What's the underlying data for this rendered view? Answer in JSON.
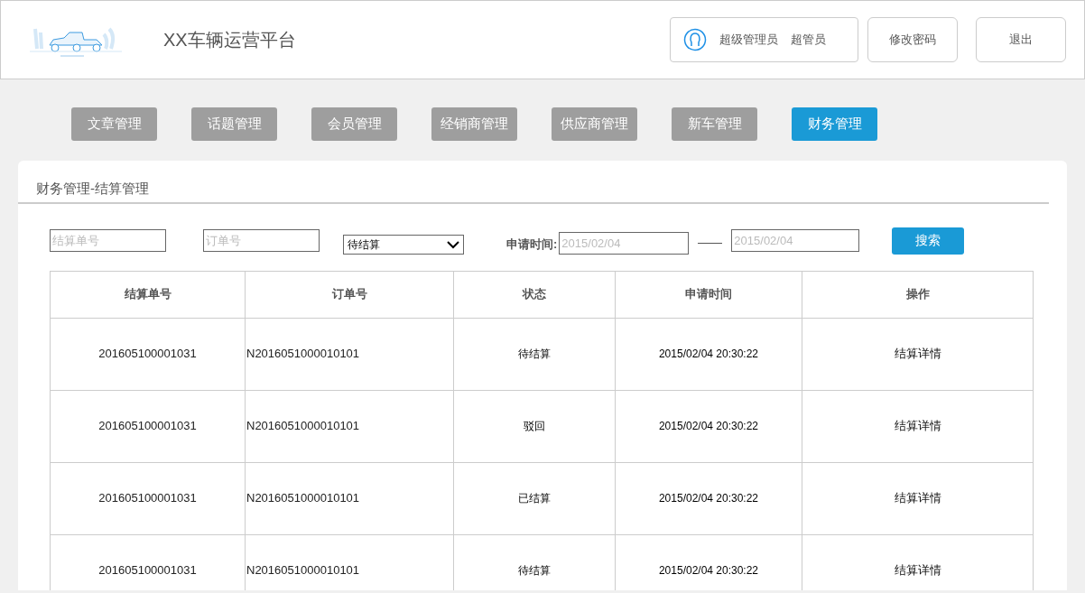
{
  "header": {
    "title": "XX车辆运营平台",
    "user_role": "超级管理员",
    "user_name": "超管员",
    "buttons": [
      "修改密码",
      "退出"
    ]
  },
  "nav": [
    {
      "label": "文章管理",
      "selected": false
    },
    {
      "label": "话题管理",
      "selected": false
    },
    {
      "label": "会员管理",
      "selected": false
    },
    {
      "label": "经销商管理",
      "selected": false
    },
    {
      "label": "供应商管理",
      "selected": false
    },
    {
      "label": "新车管理",
      "selected": false
    },
    {
      "label": "财务管理",
      "selected": true
    }
  ],
  "breadcrumb": "财务管理-结算管理",
  "filters": {
    "settlement_no": {
      "placeholder": "结算单号"
    },
    "order_no": {
      "placeholder": "订单号"
    },
    "status": "待结算",
    "date_label": "申请时间:",
    "date_from": {
      "placeholder": "2015/02/04"
    },
    "date_to": {
      "placeholder": "2015/02/04"
    },
    "search_button": "搜索"
  },
  "table": {
    "columns": [
      "结算单号",
      "订单号",
      "状态",
      "申请时间",
      "操作"
    ],
    "rows": [
      [
        "201605100001031",
        "N2016051000010101",
        "待结算",
        "2015/02/04 20:30:22",
        "结算详情"
      ],
      [
        "201605100001031",
        "N2016051000010101",
        "驳回",
        "2015/02/04 20:30:22",
        "结算详情"
      ],
      [
        "201605100001031",
        "N2016051000010101",
        "已结算",
        "2015/02/04 20:30:22",
        "结算详情"
      ],
      [
        "201605100001031",
        "N2016051000010101",
        "待结算",
        "2015/02/04 20:30:22",
        "结算详情"
      ]
    ]
  }
}
